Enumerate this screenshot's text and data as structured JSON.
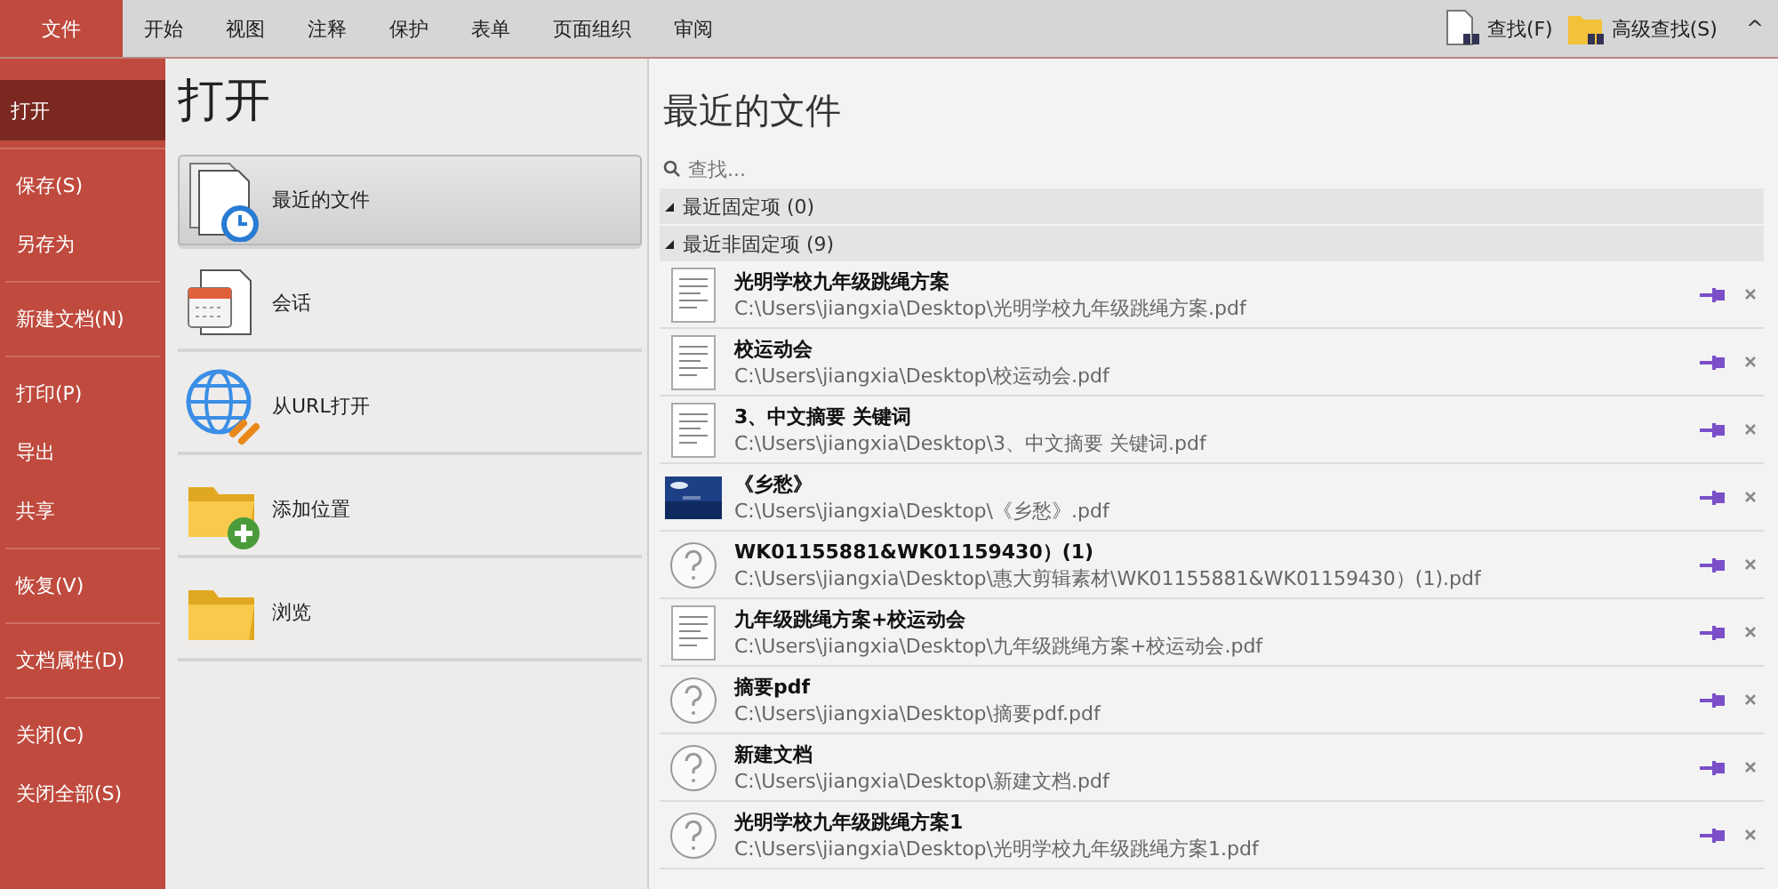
{
  "menu_bar": {
    "tabs": [
      {
        "label": "文件",
        "selected": true
      },
      {
        "label": "开始",
        "selected": false
      },
      {
        "label": "视图",
        "selected": false
      },
      {
        "label": "注释",
        "selected": false
      },
      {
        "label": "保护",
        "selected": false
      },
      {
        "label": "表单",
        "selected": false
      },
      {
        "label": "页面组织",
        "selected": false
      },
      {
        "label": "审阅",
        "selected": false
      }
    ],
    "tools": [
      {
        "label": "查找(F)",
        "kind": "find"
      },
      {
        "label": "高级查找(S)",
        "kind": "advanced"
      }
    ],
    "collapse": "^"
  },
  "sidebar": {
    "groups": [
      [
        {
          "label": "打开",
          "selected": true
        }
      ],
      [
        {
          "label": "保存(S)",
          "selected": false
        },
        {
          "label": "另存为",
          "selected": false
        }
      ],
      [
        {
          "label": "新建文档(N)",
          "selected": false
        }
      ],
      [
        {
          "label": "打印(P)",
          "selected": false
        },
        {
          "label": "导出",
          "selected": false
        },
        {
          "label": "共享",
          "selected": false
        }
      ],
      [
        {
          "label": "恢复(V)",
          "selected": false
        }
      ],
      [
        {
          "label": "文档属性(D)",
          "selected": false
        }
      ],
      [
        {
          "label": "关闭(C)",
          "selected": false
        },
        {
          "label": "关闭全部(S)",
          "selected": false
        }
      ]
    ]
  },
  "open_panel": {
    "title": "打开",
    "options": [
      {
        "label": "最近的文件",
        "kind": "recent",
        "selected": true
      },
      {
        "label": "会话",
        "kind": "session",
        "selected": false
      },
      {
        "label": "从URL打开",
        "kind": "url",
        "selected": false
      },
      {
        "label": "添加位置",
        "kind": "add",
        "selected": false
      },
      {
        "label": "浏览",
        "kind": "browse",
        "selected": false
      }
    ]
  },
  "recent_panel": {
    "title": "最近的文件",
    "search": {
      "placeholder": "查找..."
    },
    "sections": [
      {
        "label": "最近固定项 (0)",
        "expanded": true
      },
      {
        "label": "最近非固定项 (9)",
        "expanded": true,
        "files": [
          {
            "name": "光明学校九年级跳绳方案",
            "path": "C:\\Users\\jiangxia\\Desktop\\光明学校九年级跳绳方案.pdf",
            "kind": "doc"
          },
          {
            "name": "校运动会",
            "path": "C:\\Users\\jiangxia\\Desktop\\校运动会.pdf",
            "kind": "doc"
          },
          {
            "name": "3、中文摘要 关键词",
            "path": "C:\\Users\\jiangxia\\Desktop\\3、中文摘要 关键词.pdf",
            "kind": "doc"
          },
          {
            "name": "《乡愁》",
            "path": "C:\\Users\\jiangxia\\Desktop\\《乡愁》.pdf",
            "kind": "slide"
          },
          {
            "name": "WK01155881&WK01159430）(1)",
            "path": "C:\\Users\\jiangxia\\Desktop\\惠大剪辑素材\\WK01155881&WK01159430）(1).pdf",
            "kind": "unknown"
          },
          {
            "name": "九年级跳绳方案+校运动会",
            "path": "C:\\Users\\jiangxia\\Desktop\\九年级跳绳方案+校运动会.pdf",
            "kind": "doc"
          },
          {
            "name": "摘要pdf",
            "path": "C:\\Users\\jiangxia\\Desktop\\摘要pdf.pdf",
            "kind": "unknown"
          },
          {
            "name": "新建文档",
            "path": "C:\\Users\\jiangxia\\Desktop\\新建文档.pdf",
            "kind": "unknown"
          },
          {
            "name": "光明学校九年级跳绳方案1",
            "path": "C:\\Users\\jiangxia\\Desktop\\光明学校九年级跳绳方案1.pdf",
            "kind": "unknown"
          }
        ]
      }
    ]
  }
}
